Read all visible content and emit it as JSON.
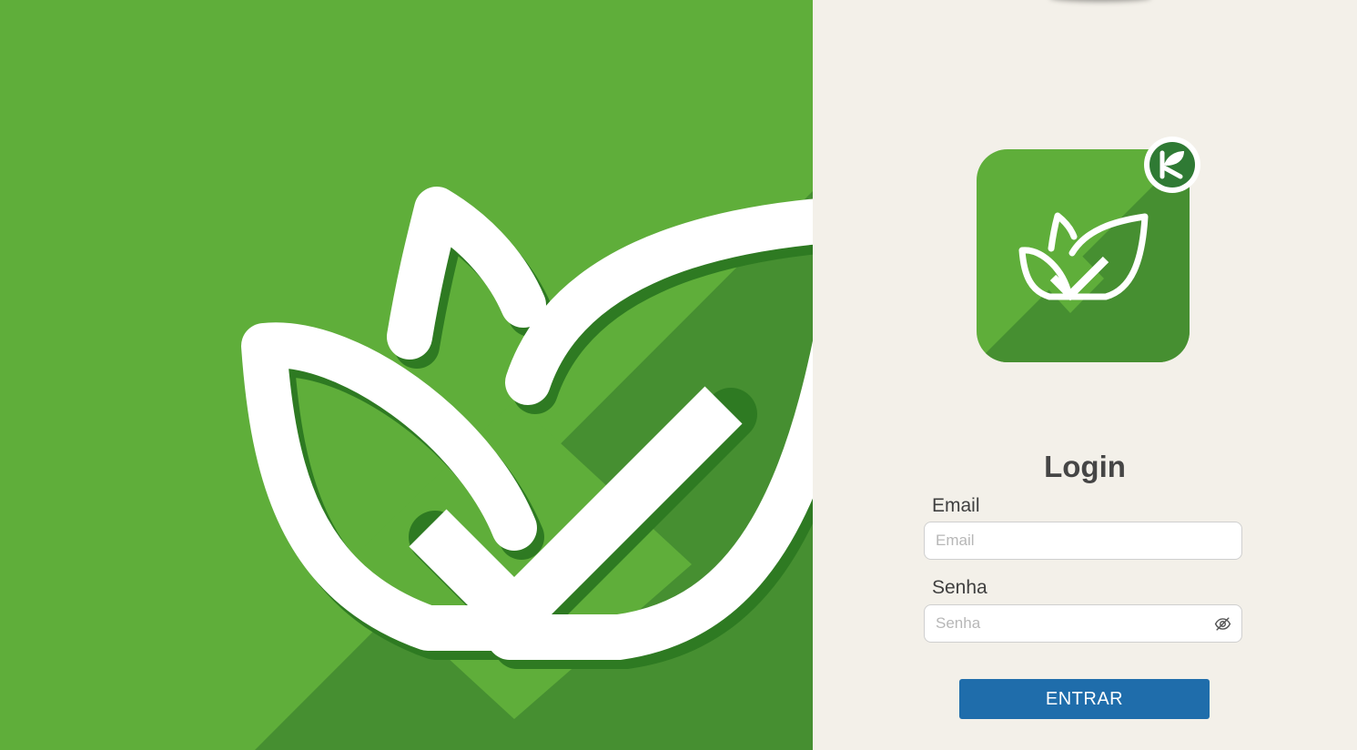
{
  "colors": {
    "brand_green": "#5fae3a",
    "brand_green_dark": "#468f31",
    "panel_background": "#f3f0e9",
    "button_blue": "#1f6dab"
  },
  "hero": {
    "icon": "leaf-checkmark-icon"
  },
  "logo": {
    "icon": "leaf-checkmark-icon",
    "badge_icon": "k-leaf-badge-icon"
  },
  "login": {
    "title": "Login",
    "email_label": "Email",
    "email_placeholder": "Email",
    "email_value": "",
    "password_label": "Senha",
    "password_placeholder": "Senha",
    "password_value": "",
    "password_toggle_icon": "eye-slash-icon",
    "submit_label": "ENTRAR"
  }
}
